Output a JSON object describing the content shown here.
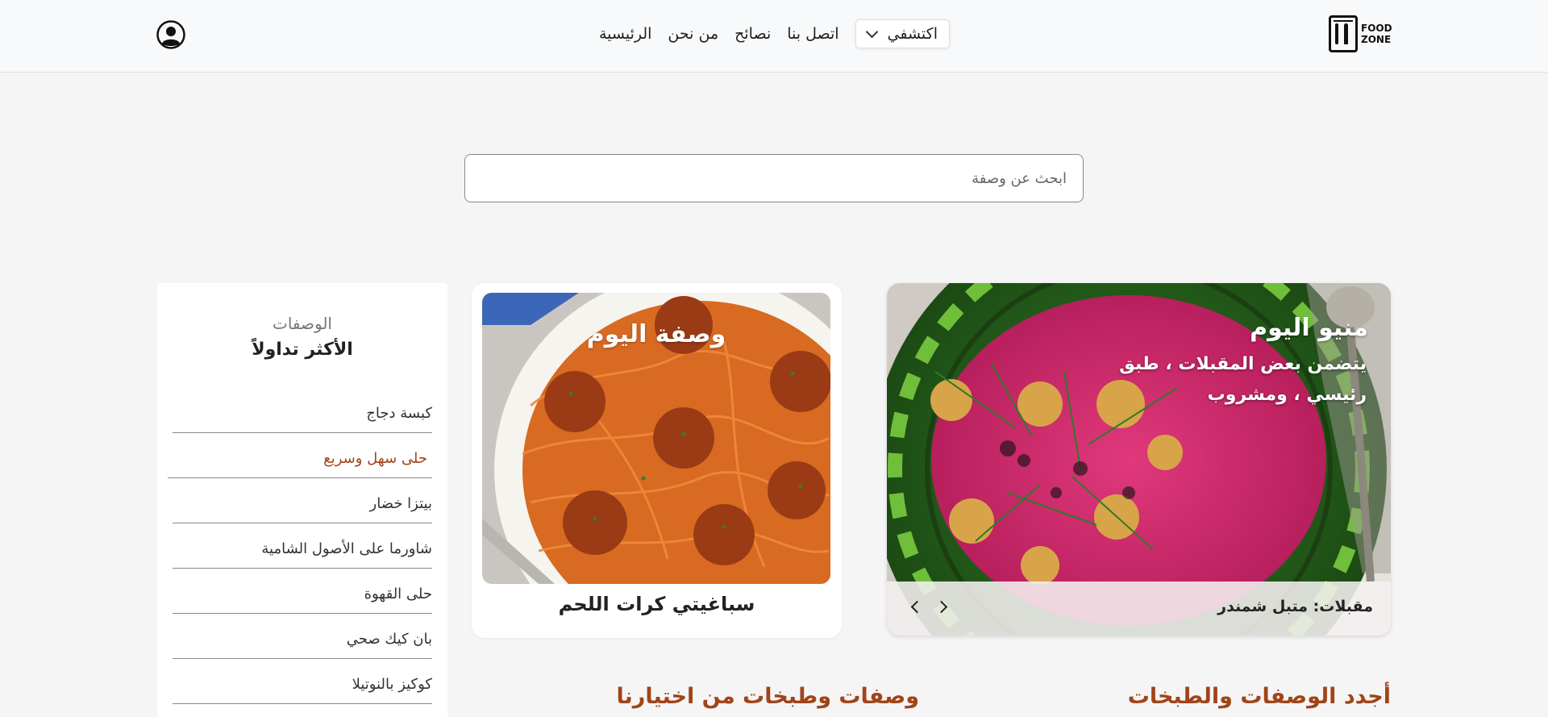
{
  "header": {
    "logo_text": [
      "FOOD",
      "ZONE"
    ],
    "nav": {
      "home": "الرئيسية",
      "about": "من نحن",
      "tips": "نصائح",
      "contact": "اتصل بنا",
      "explore": "اكتشفي"
    },
    "icons": {
      "user": "user-circle-icon",
      "dropdown": "chevron-down-icon"
    }
  },
  "search": {
    "placeholder": "ابحث عن وصفة",
    "value": ""
  },
  "sidebar": {
    "subtitle": "الوصفات",
    "title": "الأكثر تداولاً",
    "items": [
      {
        "label": "كبسة دجاج"
      },
      {
        "label": "حلى سهل وسريع",
        "active": true
      },
      {
        "label": "بيتزا خضار"
      },
      {
        "label": "شاورما على الأصول الشامية"
      },
      {
        "label": "حلى القهوة"
      },
      {
        "label": "بان كيك صحي"
      },
      {
        "label": "كوكيز بالنوتيلا"
      }
    ]
  },
  "recipe_of_day": {
    "overlay_title": "وصفة اليوم",
    "name": "سباغيتي كرات اللحم"
  },
  "menu_of_day": {
    "title": "منيو اليوم",
    "description": "يتضمن بعض المقبلات ، طبق رئيسي ، ومشروب",
    "caption": "مقبلات: متبل شمندر"
  },
  "sections": {
    "latest": "أجدد الوصفات والطبخات",
    "picks": "وصفات وطبخات من اختيارنا"
  },
  "colors": {
    "accent": "#a14419",
    "background": "#f5f5f5"
  }
}
